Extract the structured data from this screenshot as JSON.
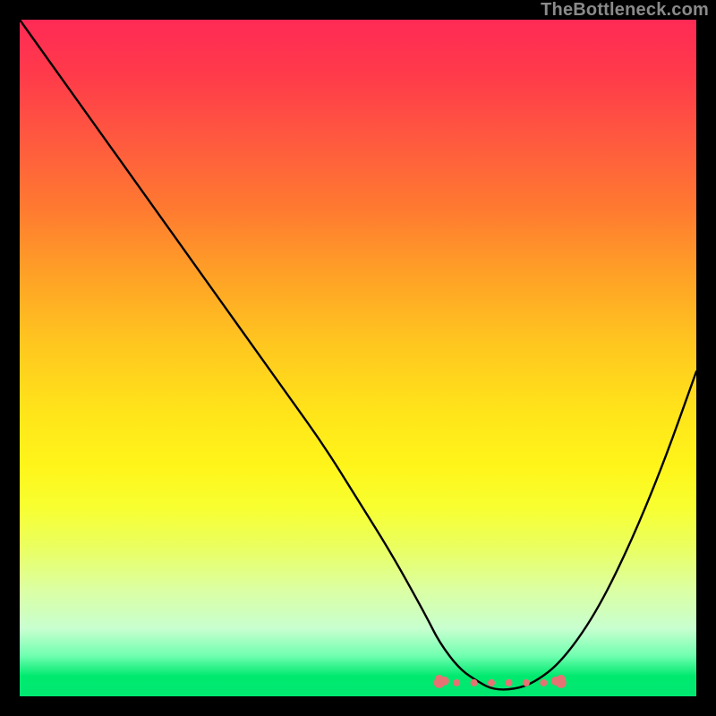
{
  "watermark": "TheBottleneck.com",
  "chart_data": {
    "type": "line",
    "title": "",
    "xlabel": "",
    "ylabel": "",
    "xlim": [
      0,
      100
    ],
    "ylim": [
      0,
      100
    ],
    "x": [
      0,
      5,
      10,
      15,
      20,
      25,
      30,
      35,
      40,
      45,
      50,
      55,
      60,
      62,
      65,
      68,
      70,
      73,
      76,
      80,
      85,
      90,
      95,
      100
    ],
    "values": [
      100,
      93,
      86,
      79,
      72,
      65,
      58,
      51,
      44,
      37,
      29,
      21,
      12,
      8,
      4,
      2,
      1,
      1,
      2,
      5,
      12,
      22,
      34,
      48
    ],
    "flat_zone": {
      "x_start": 62,
      "x_end": 80,
      "y": 2
    },
    "marker_color": "#e57373",
    "curve_color": "#000000",
    "background_gradient": {
      "top": "#ff2a55",
      "mid": "#ffe41a",
      "bottom": "#00e870"
    }
  }
}
